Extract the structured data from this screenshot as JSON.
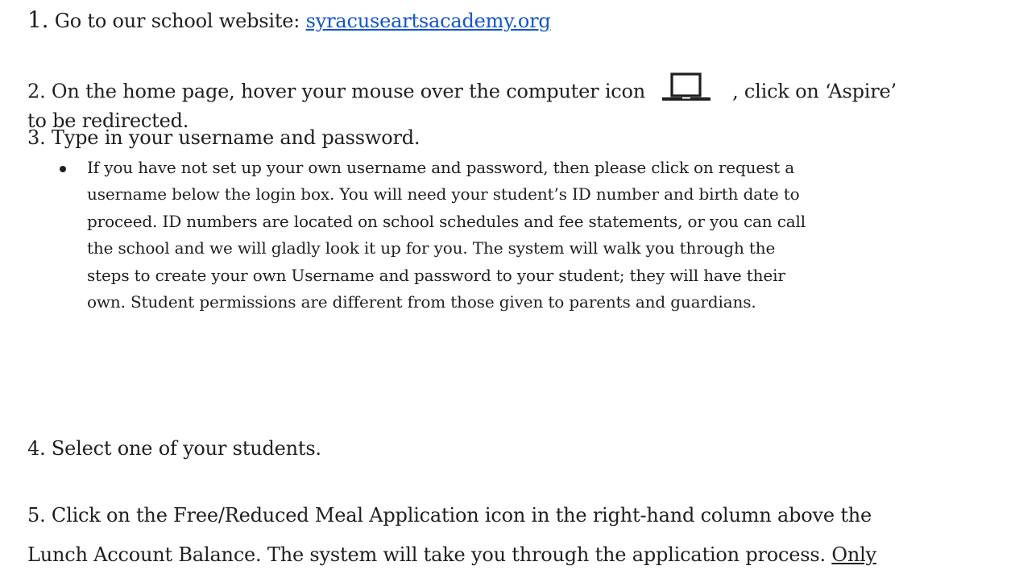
{
  "steps": {
    "step1": {
      "number": "1.",
      "text": " Go to our school website: ",
      "link": "syracuseartsacademy.org"
    },
    "step2": {
      "line1_before_icon": "2. On the home page, hover your mouse over the computer icon",
      "icon": "laptop-icon",
      "line1_after_icon": ", click on  ‘Aspire’",
      "line2": "to be redirected."
    },
    "step3": {
      "text": "3. Type in your username and password.",
      "bullet_lines": [
        "If you have not set up your own username and password, then please click on request a",
        "username below the login box. You will need your student’s ID number and birth date to",
        "proceed. ID numbers are located on school schedules and fee statements, or you can call",
        "the school and we will gladly look it up for you. The system will walk you through the",
        "steps to create your own Username and password to your student; they will have their",
        "own. Student permissions are different from those given to parents and guardians."
      ]
    },
    "step4": {
      "text": "4. Select one of your students."
    },
    "step5": {
      "line1": "5. Click on the Free/Reduced Meal Application icon in the right-hand column above the",
      "line2": "Lunch Account Balance. The system will take you through the application process. ",
      "line2_underlined": "Only"
    }
  }
}
